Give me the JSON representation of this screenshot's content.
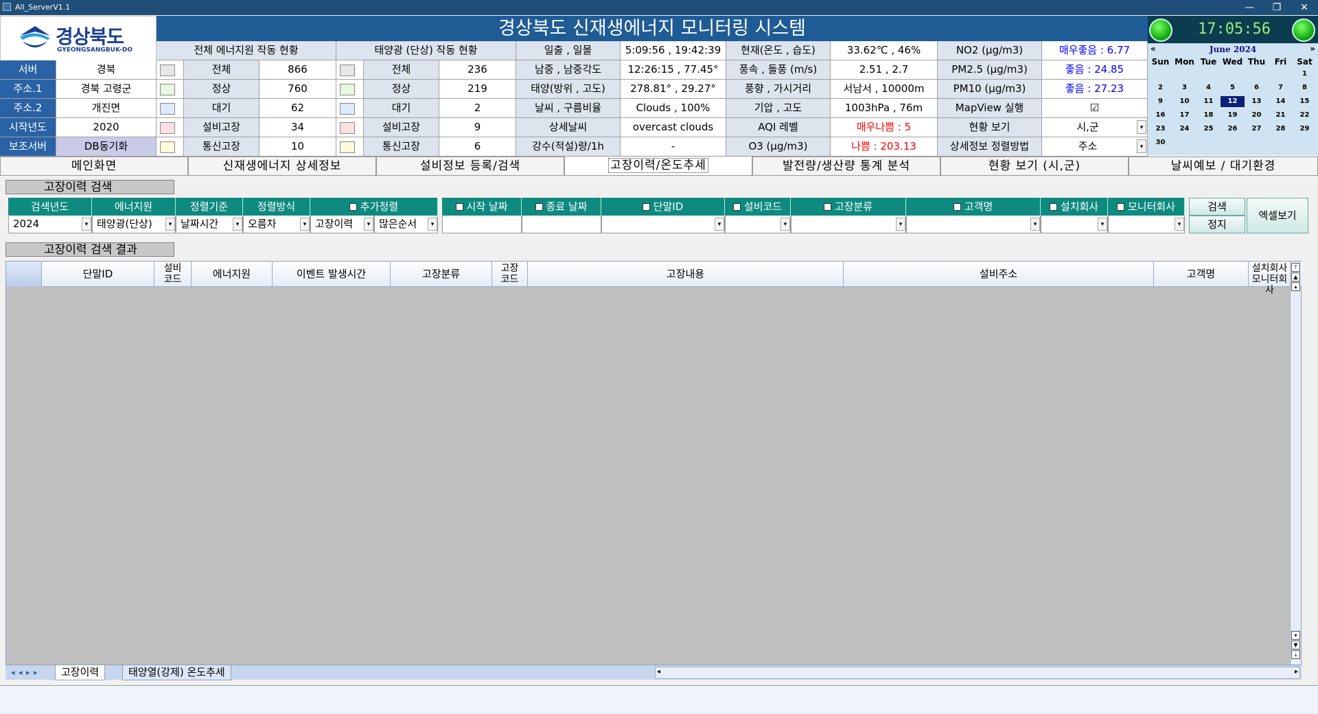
{
  "window": {
    "title": "All_ServerV1.1",
    "min": "—",
    "restore": "❐",
    "close": "✕"
  },
  "logo": {
    "text": "경상북도",
    "sub": "GYEONGSANGBUK-DO"
  },
  "banner": "경상북도 신재생에너지 모니터링 시스템",
  "clock": "17:05:56 PM",
  "left": {
    "rows": [
      {
        "label": "서버",
        "value": "경북"
      },
      {
        "label": "주소.1",
        "value": "경북 고령군"
      },
      {
        "label": "주소.2",
        "value": "개진면"
      },
      {
        "label": "시작년도",
        "value": "2020"
      },
      {
        "label": "보조서버",
        "value": "DB동기화"
      }
    ]
  },
  "overall": {
    "title": "전체 에너지원 작동 현황",
    "rows": [
      {
        "label": "전체",
        "value": "866",
        "color": "#e6e6e6"
      },
      {
        "label": "정상",
        "value": "760",
        "color": "#e6f8e0"
      },
      {
        "label": "대기",
        "value": "62",
        "color": "#dceafc"
      },
      {
        "label": "설비고장",
        "value": "34",
        "color": "#fde0e0"
      },
      {
        "label": "통신고장",
        "value": "10",
        "color": "#fdf9dc"
      }
    ]
  },
  "solar": {
    "title": "태양광 (단상) 작동 현황",
    "rows": [
      {
        "label": "전체",
        "value": "236"
      },
      {
        "label": "정상",
        "value": "219"
      },
      {
        "label": "대기",
        "value": "2"
      },
      {
        "label": "설비고장",
        "value": "9"
      },
      {
        "label": "통신고장",
        "value": "6"
      }
    ]
  },
  "weather": {
    "rows": [
      {
        "l1": "일출 , 일몰",
        "v1": "5:09:56 , 19:42:39",
        "l2": "현재(온도 , 습도)",
        "v2": "33.62℃ , 46%",
        "l3": "NO2 (μg/m3)",
        "v3": "매우좋음 : 6.77",
        "c3": "#0000ff"
      },
      {
        "l1": "남중 , 남중각도",
        "v1": "12:26:15 , 77.45°",
        "l2": "풍속 , 돌풍 (m/s)",
        "v2": "2.51 , 2.7",
        "l3": "PM2.5 (μg/m3)",
        "v3": "좋음 : 24.85",
        "c3": "#0000ff"
      },
      {
        "l1": "태양(방위 , 고도)",
        "v1": "278.81° , 29.27°",
        "l2": "풍향 , 가시거리",
        "v2": "서남서 , 10000m",
        "l3": "PM10 (μg/m3)",
        "v3": "좋음 : 27.23",
        "c3": "#0000ff"
      },
      {
        "l1": "날씨 , 구름비율",
        "v1": "Clouds , 100%",
        "l2": "기압 , 고도",
        "v2": "1003hPa , 76m",
        "l3": "MapView 실행",
        "v3": "☑",
        "c3": "#000000"
      },
      {
        "l1": "상세날씨",
        "v1": "overcast clouds",
        "l2": "AQI 레벨",
        "v2": "매우나쁨 : 5",
        "c2": "#ff0000",
        "l3": "현황 보기",
        "v3": "시,군",
        "c3": "#000000"
      },
      {
        "l1": "강수(적설)량/1h",
        "v1": "-",
        "l2": "O3 (μg/m3)",
        "v2": "나쁨 : 203.13",
        "c2": "#ff0000",
        "l3": "상세정보 정렬방법",
        "v3": "주소",
        "c3": "#000000"
      }
    ]
  },
  "calendar": {
    "month": "June 2024",
    "prev": "«",
    "next": "»",
    "days": [
      "Sun",
      "Mon",
      "Tue",
      "Wed",
      "Thu",
      "Fri",
      "Sat"
    ],
    "selected": "12",
    "dates": [
      [
        "",
        "",
        "",
        "",
        "",
        "",
        "1"
      ],
      [
        "2",
        "3",
        "4",
        "5",
        "6",
        "7",
        "8"
      ],
      [
        "9",
        "10",
        "11",
        "12",
        "13",
        "14",
        "15"
      ],
      [
        "16",
        "17",
        "18",
        "19",
        "20",
        "21",
        "22"
      ],
      [
        "23",
        "24",
        "25",
        "26",
        "27",
        "28",
        "29"
      ],
      [
        "30",
        "",
        "",
        "",
        "",
        "",
        ""
      ]
    ]
  },
  "tabs": [
    "메인화면",
    "신재생에너지 상세정보",
    "설비정보 등록/검색",
    "고장이력/온도추세",
    "발전량/생산량 통계 분석",
    "현황 보기 (시,군)",
    "날씨예보 / 대기환경"
  ],
  "search": {
    "title": "고장이력 검색",
    "headers": [
      "검색년도",
      "에너지원",
      "정렬기준",
      "정렬방식",
      "추가정렬",
      "시작 날짜",
      "종료 날짜",
      "단말ID",
      "설비코드",
      "고장분류",
      "고객명",
      "설치회사",
      "모니터회사"
    ],
    "values": [
      "2024",
      "태양광(단상)",
      "날짜시간",
      "오름차",
      "고장이력",
      "많은순서",
      "",
      "",
      "",
      "",
      "",
      "",
      ""
    ],
    "search_btn": "검색",
    "stop_btn": "정지",
    "excel_btn": "엑셀보기"
  },
  "result": {
    "title": "고장이력 검색 결과",
    "columns": [
      "단말ID",
      "설비\n코드",
      "에너지원",
      "이벤트 발생시간",
      "고장분류",
      "고장\n코드",
      "고장내용",
      "설비주소",
      "고객명",
      "설치회사\n모니터회사"
    ]
  },
  "sheets": [
    "고장이력",
    "태양열(강제) 온도추세"
  ],
  "sheetnav": "◂ ◂ ▸ ▸"
}
